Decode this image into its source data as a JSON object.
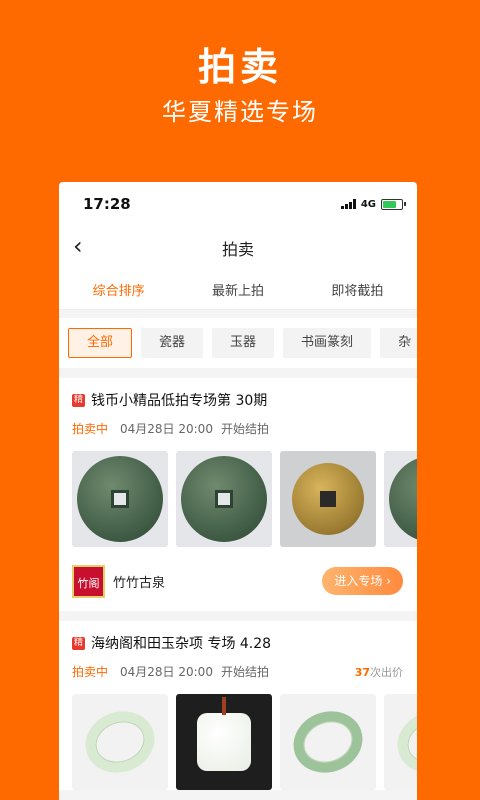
{
  "promo": {
    "title": "拍卖",
    "subtitle": "华夏精选专场"
  },
  "statusbar": {
    "time": "17:28",
    "network": "4G",
    "battery_level": 0.7
  },
  "navbar": {
    "back_icon": "chevron-left-icon",
    "title": "拍卖"
  },
  "sort_tabs": [
    {
      "label": "综合排序",
      "active": true
    },
    {
      "label": "最新上拍",
      "active": false
    },
    {
      "label": "即将截拍",
      "active": false
    }
  ],
  "categories": [
    {
      "label": "全部",
      "active": true
    },
    {
      "label": "瓷器",
      "active": false
    },
    {
      "label": "玉器",
      "active": false
    },
    {
      "label": "书画篆刻",
      "active": false
    },
    {
      "label": "杂",
      "active": false
    }
  ],
  "auctions": [
    {
      "tag": "精",
      "title": "钱币小精品低拍专场第 30期",
      "status": "拍卖中",
      "date": "04月28日 20:00",
      "action_text": "开始结拍",
      "shop": {
        "logo_text": "竹阁",
        "name": "竹竹古泉"
      },
      "enter_label": "进入专场 ›"
    },
    {
      "tag": "精",
      "title": "海纳阁和田玉杂项 专场 4.28",
      "status": "拍卖中",
      "date": "04月28日 20:00",
      "action_text": "开始结拍",
      "bids_count": "37",
      "bids_suffix": "次出价"
    }
  ],
  "colors": {
    "brand": "#FF6A00",
    "tag": "#E8392F"
  }
}
